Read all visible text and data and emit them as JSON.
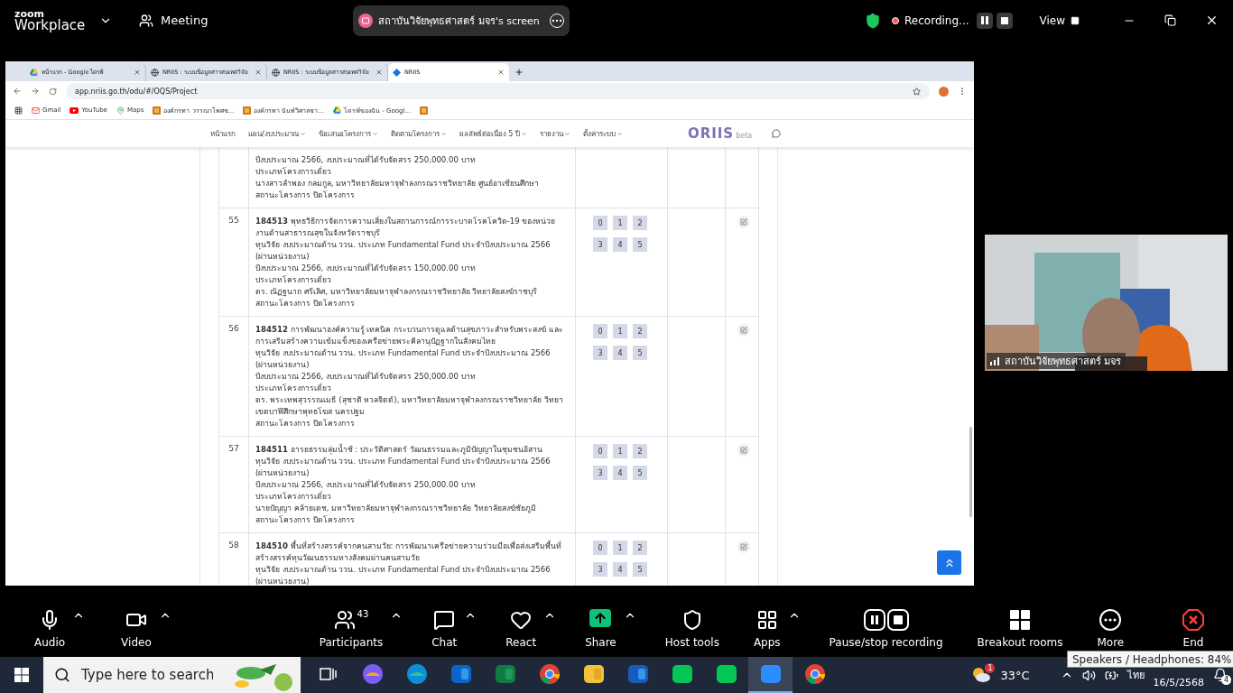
{
  "zoom_bar": {
    "logo_top": "zoom",
    "logo_bottom": "Workplace",
    "meeting": "Meeting",
    "share_title": "สถาบันวิจัยพุทธศาสตร์ มจร's screen",
    "recording": "Recording...",
    "view": "View"
  },
  "browser": {
    "tabs": [
      {
        "title": "หน้าแรก - Google ไดรฟ์",
        "kind": "drive",
        "selected": false
      },
      {
        "title": "NRIIS : ระบบข้อมูลสารสนเทศวิจัย",
        "kind": "globe",
        "selected": false
      },
      {
        "title": "NRIIS : ระบบข้อมูลสารสนเทศวิจัย",
        "kind": "globe",
        "selected": false
      },
      {
        "title": "NRIIS",
        "kind": "site",
        "selected": true
      }
    ],
    "address": "app.nriis.go.th/odu/#/OQS/Project",
    "bookmarks": [
      {
        "label": "Gmail",
        "kind": "mail"
      },
      {
        "label": "YouTube",
        "kind": "video"
      },
      {
        "label": "Maps",
        "kind": "pin"
      },
      {
        "label": "องค์กรทา วรรณาโพศช...",
        "kind": "folder"
      },
      {
        "label": "องค์กรทา นันท์วิศาลชา...",
        "kind": "folder"
      },
      {
        "label": "ไดรฟ์ของฉัน - Googl...",
        "kind": "drive"
      },
      {
        "kind": "folder"
      }
    ]
  },
  "site": {
    "nav": [
      {
        "label": "หน้าแรก",
        "dropdown": false
      },
      {
        "label": "แผน/งบประมาณ",
        "dropdown": true
      },
      {
        "label": "ข้อเสนอโครงการ",
        "dropdown": true
      },
      {
        "label": "ติดตามโครงการ",
        "dropdown": true
      },
      {
        "label": "ผลลัพธ์ต่อเนื่อง 5 ปี",
        "dropdown": true
      },
      {
        "label": "รายงาน",
        "dropdown": true
      },
      {
        "label": "ตั้งค่าระบบ",
        "dropdown": true
      }
    ],
    "logo": "ORIIS",
    "logo_tag": "beta",
    "rows": [
      {
        "lines": [
          "ปีงบประมาณ 2566, งบประมาณที่ได้รับจัดสรร 250,000.00 บาท",
          "ประเภทโครงการเดี่ยว",
          "นางสาวลำพอง กลมกูล, มหาวิทยาลัยมหาจุฬาลงกรณราชวิทยาลัย ศูนย์อาเซียนศึกษา",
          "สถานะโครงการ ปิดโครงการ"
        ],
        "edit": false
      },
      {
        "number": "55",
        "lines": [
          "**184513** พุทธวิธีการจัดการความเสี่ยงในสถานการณ์การระบาดโรคโควิด-19 ของหน่วยงานด้านสาธารณสุขในจังหวัดราชบุรี",
          "ทุนวิจัย งบประมาณด้าน ววน. ประเภท Fundamental Fund ประจำปีงบประมาณ 2566 (ผ่านหน่วยงาน)",
          "ปีงบประมาณ 2566, งบประมาณที่ได้รับจัดสรร 150,000.00 บาท",
          "ประเภทโครงการเดี่ยว",
          "ดร. ณัฏฐนาถ ศรีเลิศ, มหาวิทยาลัยมหาจุฬาลงกรณราชวิทยาลัย วิทยาลัยสงฆ์ราชบุรี",
          "สถานะโครงการ ปิดโครงการ"
        ],
        "chips": [
          "0",
          "1",
          "2",
          "3",
          "4",
          "5"
        ],
        "edit": true
      },
      {
        "number": "56",
        "lines": [
          "**184512** การพัฒนาองค์ความรู้ เทคนิค กระบวนการดูแลด้านสุขภาวะสำหรับพระสงฆ์ และ การเสริมสร้างความเข้มแข็งของเครือข่ายพระคิลานุปัฏฐากในสังคมไทย",
          "ทุนวิจัย งบประมาณด้าน ววน. ประเภท Fundamental Fund ประจำปีงบประมาณ 2566 (ผ่านหน่วยงาน)",
          "ปีงบประมาณ 2566, งบประมาณที่ได้รับจัดสรร 250,000.00 บาท",
          "ประเภทโครงการเดี่ยว",
          "ดร. พระเทพสุวรรณเมธี (สุชาติ หวลจิตต์), มหาวิทยาลัยมหาจุฬาลงกรณราชวิทยาลัย วิทยาเขตบาฬีศึกษาพุทธโฆส นครปฐม",
          "สถานะโครงการ ปิดโครงการ"
        ],
        "chips": [
          "0",
          "1",
          "2",
          "3",
          "4",
          "5"
        ],
        "edit": true
      },
      {
        "number": "57",
        "lines": [
          "**184511** อารยธรรมลุ่มน้ำชี : ประวัติศาสตร์ วัฒนธรรมและภูมิปัญญาในชุมชนอีสาน",
          "ทุนวิจัย งบประมาณด้าน ววน. ประเภท Fundamental Fund ประจำปีงบประมาณ 2566 (ผ่านหน่วยงาน)",
          "ปีงบประมาณ 2566, งบประมาณที่ได้รับจัดสรร 250,000.00 บาท",
          "ประเภทโครงการเดี่ยว",
          "นายปัญญา คล้ายเดช, มหาวิทยาลัยมหาจุฬาลงกรณราชวิทยาลัย วิทยาลัยสงฆ์ชัยภูมิ",
          "สถานะโครงการ ปิดโครงการ"
        ],
        "chips": [
          "0",
          "1",
          "2",
          "3",
          "4",
          "5"
        ],
        "edit": true
      },
      {
        "number": "58",
        "lines": [
          "**184510** พื้นที่สร้างสรรค์จากคนสามวัย: การพัฒนาเครือข่ายความร่วมมือเพื่อส่งเสริมพื้นที่สร้างสรรค์ทุนวัฒนธรรมทางสังคมผ่านคนสามวัย",
          "ทุนวิจัย งบประมาณด้าน ววน. ประเภท Fundamental Fund ประจำปีงบประมาณ 2566 (ผ่านหน่วยงาน)"
        ],
        "chips": [
          "0",
          "1",
          "2",
          "3",
          "4",
          "5"
        ],
        "edit": true
      }
    ]
  },
  "video_tile": {
    "kind": "picture",
    "name": "สถาบันวิจัยพุทธศาสตร์ มจร"
  },
  "toolbar": {
    "items": [
      {
        "label": "Audio",
        "kind": "mic",
        "caret": true
      },
      {
        "label": "Video",
        "kind": "camera",
        "caret": true
      },
      {
        "label": "Participants",
        "kind": "people",
        "count": "43",
        "caret": true
      },
      {
        "label": "Chat",
        "kind": "chat",
        "caret": true
      },
      {
        "label": "React",
        "kind": "heart",
        "caret": true
      },
      {
        "label": "Share",
        "kind": "share",
        "caret": true
      },
      {
        "label": "Host tools",
        "kind": "shield",
        "caret": false
      },
      {
        "label": "Apps",
        "kind": "apps",
        "caret": true
      },
      {
        "label": "Pause/stop recording",
        "kind": "record",
        "caret": false
      },
      {
        "label": "Breakout rooms",
        "kind": "rooms",
        "caret": false
      },
      {
        "label": "More",
        "kind": "more",
        "caret": false
      },
      {
        "label": "End",
        "kind": "end",
        "caret": false
      }
    ]
  },
  "taskbar": {
    "search_placeholder": "Type here to search",
    "apps": [
      {
        "kind": "taskview",
        "selected": false
      },
      {
        "kind": "copilot",
        "selected": false
      },
      {
        "kind": "edge",
        "selected": false
      },
      {
        "kind": "outlook",
        "selected": false
      },
      {
        "kind": "excel",
        "selected": false
      },
      {
        "kind": "chrome",
        "selected": false
      },
      {
        "kind": "files",
        "selected": false
      },
      {
        "kind": "word",
        "selected": false
      },
      {
        "kind": "line",
        "selected": false
      },
      {
        "kind": "line",
        "selected": false
      },
      {
        "kind": "zoom",
        "selected": true
      },
      {
        "kind": "chrome",
        "selected": false
      }
    ],
    "weather_badge": "1",
    "temperature": "33°C",
    "language": "ไทย",
    "date": "16/5/2568",
    "notifications": "4",
    "tooltip": "Speakers / Headphones: 84%"
  }
}
